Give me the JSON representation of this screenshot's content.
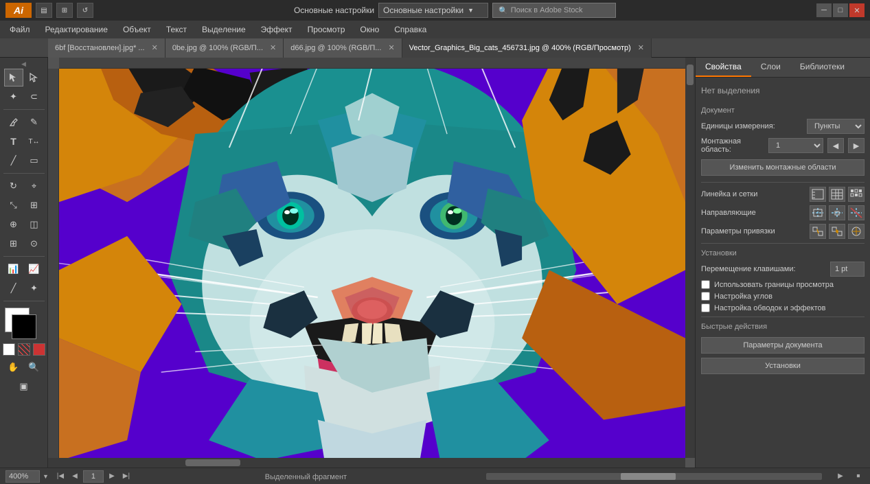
{
  "app": {
    "logo": "Ai",
    "title": "Основные настройки",
    "search_placeholder": "Поиск в Adobe Stock"
  },
  "window_controls": {
    "minimize": "─",
    "restore": "□",
    "close": "✕"
  },
  "menu": {
    "items": [
      "Файл",
      "Редактирование",
      "Объект",
      "Текст",
      "Выделение",
      "Эффект",
      "Просмотр",
      "Окно",
      "Справка"
    ]
  },
  "tabs": [
    {
      "label": "6bf [Восстановлен].jpg* ...",
      "active": false
    },
    {
      "label": "0be.jpg @ 100% (RGB/П...",
      "active": false
    },
    {
      "label": "d66.jpg @ 100% (RGB/П...",
      "active": false
    },
    {
      "label": "Vector_Graphics_Big_cats_456731.jpg @ 400% (RGB/Просмотр)",
      "active": true
    }
  ],
  "right_panel": {
    "tabs": [
      "Свойства",
      "Слои",
      "Библиотеки"
    ],
    "active_tab": "Свойства",
    "no_selection": "Нет выделения",
    "document_section": "Документ",
    "units_label": "Единицы измерения:",
    "units_value": "Пункты",
    "artboard_label": "Монтажная область:",
    "artboard_value": "1",
    "change_artboard_btn": "Изменить монтажные области",
    "ruler_grid_label": "Линейка и сетки",
    "guides_label": "Направляющие",
    "snap_label": "Параметры привязки",
    "settings_section": "Установки",
    "keyboard_move_label": "Перемещение клавишами:",
    "keyboard_move_value": "1 pt",
    "use_view_bounds_label": "Использовать границы просмотра",
    "use_view_bounds_checked": false,
    "corner_widget_label": "Настройка углов",
    "corner_widget_checked": false,
    "strokes_effects_label": "Настройка обводок и эффектов",
    "strokes_effects_checked": false,
    "quick_actions": "Быстрые действия",
    "doc_settings_btn": "Параметры документа",
    "preferences_btn": "Установки"
  },
  "status_bar": {
    "zoom": "400%",
    "page": "1",
    "selection_text": "Выделенный фрагмент"
  },
  "tools": [
    {
      "icon": "↖",
      "name": "selection-tool"
    },
    {
      "icon": "↗",
      "name": "direct-selection-tool"
    },
    {
      "icon": "✦",
      "name": "magic-wand-tool"
    },
    {
      "icon": "∞",
      "name": "lasso-tool"
    },
    {
      "icon": "✒",
      "name": "pen-tool"
    },
    {
      "icon": "✏",
      "name": "pencil-tool"
    },
    {
      "icon": "T",
      "name": "type-tool"
    },
    {
      "icon": "/",
      "name": "line-tool"
    },
    {
      "icon": "▭",
      "name": "rect-tool"
    },
    {
      "icon": "⌖",
      "name": "rotate-tool"
    },
    {
      "icon": "⊞",
      "name": "scale-tool"
    },
    {
      "icon": "◈",
      "name": "blend-tool"
    },
    {
      "icon": "☁",
      "name": "gradient-tool"
    },
    {
      "icon": "●",
      "name": "mesh-tool"
    },
    {
      "icon": "⊕",
      "name": "shape-builder"
    },
    {
      "icon": "⊗",
      "name": "live-paint"
    },
    {
      "icon": "✂",
      "name": "scissors-tool"
    },
    {
      "icon": "☞",
      "name": "hand-tool"
    },
    {
      "icon": "⊙",
      "name": "zoom-tool"
    }
  ]
}
